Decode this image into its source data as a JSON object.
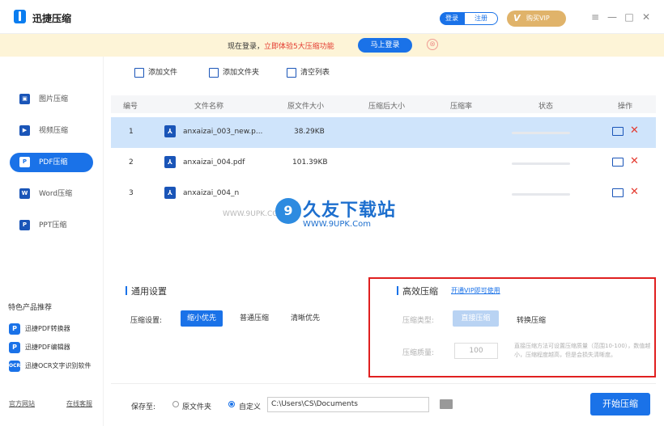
{
  "titlebar": {
    "app_name": "迅捷压缩",
    "login_label": "登录",
    "register_label": "注册",
    "vip_label": "购买VIP",
    "menu_glyph": "≡",
    "minimize_glyph": "—",
    "maximize_glyph": "□",
    "close_glyph": "✕"
  },
  "promo": {
    "text_prefix": "现在登录，",
    "text_highlight": "立即体验5大压缩功能",
    "login_button": "马上登录",
    "close_glyph": "⊗"
  },
  "sidebar": {
    "items": [
      {
        "label": "图片压缩",
        "icon": "image-icon",
        "active": false
      },
      {
        "label": "视频压缩",
        "icon": "video-icon",
        "active": false
      },
      {
        "label": "PDF压缩",
        "icon": "pdf-icon",
        "active": true
      },
      {
        "label": "Word压缩",
        "icon": "word-icon",
        "active": false
      },
      {
        "label": "PPT压缩",
        "icon": "ppt-icon",
        "active": false
      }
    ],
    "feature_title": "特色产品推荐",
    "features": [
      {
        "label": "迅捷PDF转换器",
        "icon": "pdf-converter-icon"
      },
      {
        "label": "迅捷PDF编辑器",
        "icon": "pdf-editor-icon"
      },
      {
        "label": "迅捷OCR文字识别软件",
        "icon": "ocr-icon"
      }
    ],
    "footer_links": [
      "官方网站",
      "在线客服"
    ]
  },
  "toolbar": {
    "add_file": "添加文件",
    "add_folder": "添加文件夹",
    "clear_list": "清空列表"
  },
  "table": {
    "headers": [
      "编号",
      "文件名称",
      "原文件大小",
      "压缩后大小",
      "压缩率",
      "状态",
      "操作"
    ],
    "rows": [
      {
        "index": "1",
        "name": "anxaizai_003_new.p...",
        "size": "38.29KB",
        "selected": true
      },
      {
        "index": "2",
        "name": "anxaizai_004.pdf",
        "size": "101.39KB",
        "selected": false
      },
      {
        "index": "3",
        "name": "anxaizai_004_n",
        "size": "",
        "selected": false
      }
    ]
  },
  "watermark": {
    "logo_glyph": "9",
    "title": "久友下载站",
    "url": "WWW.9UPK.Com",
    "url_faint": "WWW.9UPK.COM"
  },
  "general_settings": {
    "title": "通用设置",
    "compress_label": "压缩设置:",
    "options": [
      "缩小优先",
      "普通压缩",
      "清晰优先"
    ],
    "selected": "缩小优先"
  },
  "high_settings": {
    "title": "高效压缩",
    "vip_link": "开通VIP即可使用",
    "type_label": "压缩类型:",
    "type_options": [
      "直接压缩",
      "转换压缩"
    ],
    "quality_label": "压缩质量:",
    "quality_value": "100",
    "note": "直接压缩方法可设置压缩质量（范围10-100），数值越小，压缩程度越高，但是会损失清晰度。"
  },
  "save": {
    "label": "保存至:",
    "options": [
      "原文件夹",
      "自定义"
    ],
    "selected": "自定义",
    "path": "C:\\Users\\CS\\Documents",
    "start_button": "开始压缩"
  }
}
